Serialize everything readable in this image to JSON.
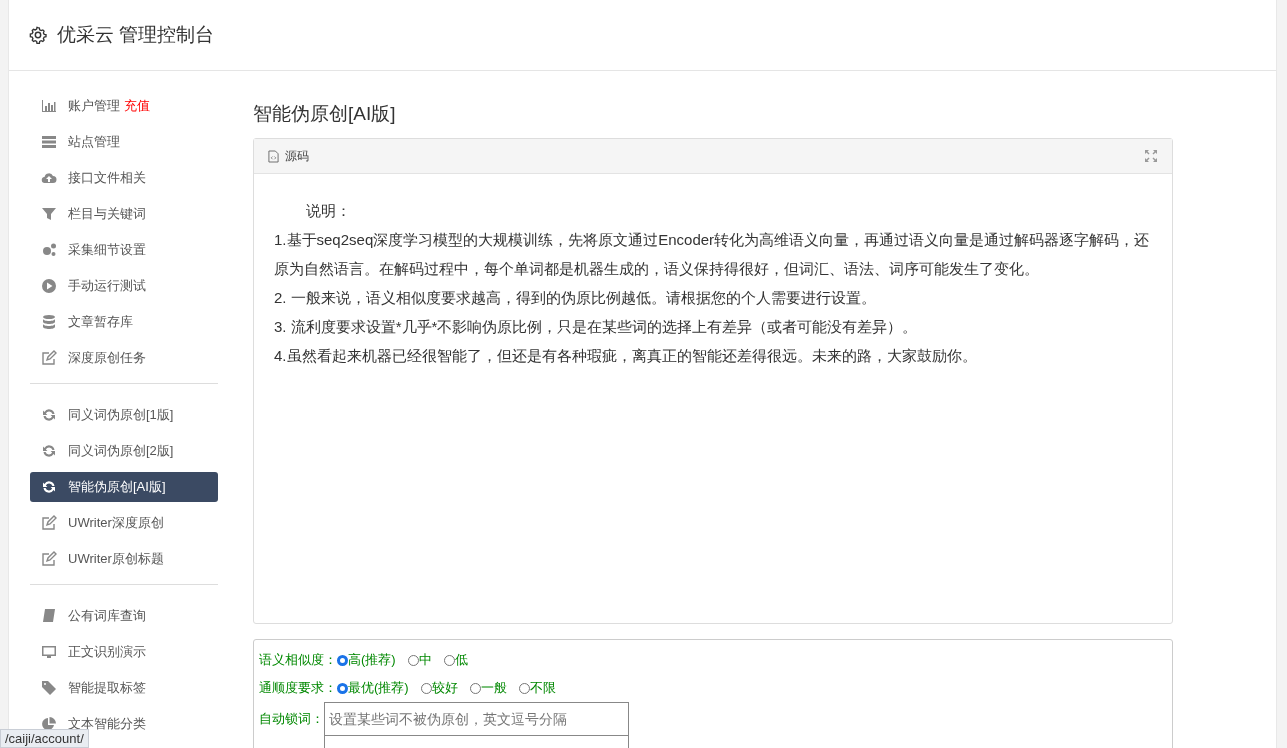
{
  "header": {
    "title": "优采云 管理控制台"
  },
  "sidebar": {
    "groups": [
      {
        "items": [
          {
            "label": "账户管理",
            "badge": "充值",
            "selected": false
          },
          {
            "label": "站点管理",
            "selected": false
          },
          {
            "label": "接口文件相关",
            "selected": false
          },
          {
            "label": "栏目与关键词",
            "selected": false
          },
          {
            "label": "采集细节设置",
            "selected": false
          },
          {
            "label": "手动运行测试",
            "selected": false
          },
          {
            "label": "文章暂存库",
            "selected": false
          },
          {
            "label": "深度原创任务",
            "selected": false
          }
        ]
      },
      {
        "items": [
          {
            "label": "同义词伪原创[1版]",
            "selected": false
          },
          {
            "label": "同义词伪原创[2版]",
            "selected": false
          },
          {
            "label": "智能伪原创[AI版]",
            "selected": true
          },
          {
            "label": "UWriter深度原创",
            "selected": false
          },
          {
            "label": "UWriter原创标题",
            "selected": false
          }
        ]
      },
      {
        "items": [
          {
            "label": "公有词库查询",
            "selected": false
          },
          {
            "label": "正文识别演示",
            "selected": false
          },
          {
            "label": "智能提取标签",
            "selected": false
          },
          {
            "label": "文本智能分类",
            "selected": false
          }
        ]
      }
    ]
  },
  "content": {
    "title": "智能伪原创[AI版]",
    "editor": {
      "tab": "源码",
      "lines": [
        "说明：",
        "1.基于seq2seq深度学习模型的大规模训练，先将原文通过Encoder转化为高维语义向量，再通过语义向量是通过解码器逐字解码，还原为自然语言。在解码过程中，每个单词都是机器生成的，语义保持得很好，但词汇、语法、词序可能发生了变化。",
        "2. 一般来说，语义相似度要求越高，得到的伪原比例越低。请根据您的个人需要进行设置。",
        "3. 流利度要求设置*几乎*不影响伪原比例，只是在某些词的选择上有差异（或者可能没有差异）。",
        "4.虽然看起来机器已经很智能了，但还是有各种瑕疵，离真正的智能还差得很远。未来的路，大家鼓励你。"
      ]
    },
    "options": [
      {
        "label": "语义相似度：",
        "choices": [
          {
            "label": "高(推荐)",
            "selected": true
          },
          {
            "label": "中",
            "selected": false
          },
          {
            "label": "低",
            "selected": false
          }
        ]
      },
      {
        "label": "通顺度要求：",
        "choices": [
          {
            "label": "最优(推荐)",
            "selected": true
          },
          {
            "label": "较好",
            "selected": false
          },
          {
            "label": "一般",
            "selected": false
          },
          {
            "label": "不限",
            "selected": false
          }
        ]
      }
    ],
    "lock_words": {
      "label": "自动锁词：",
      "placeholder": "设置某些词不被伪原创，英文逗号分隔"
    }
  },
  "status_url": "/caiji/account/"
}
